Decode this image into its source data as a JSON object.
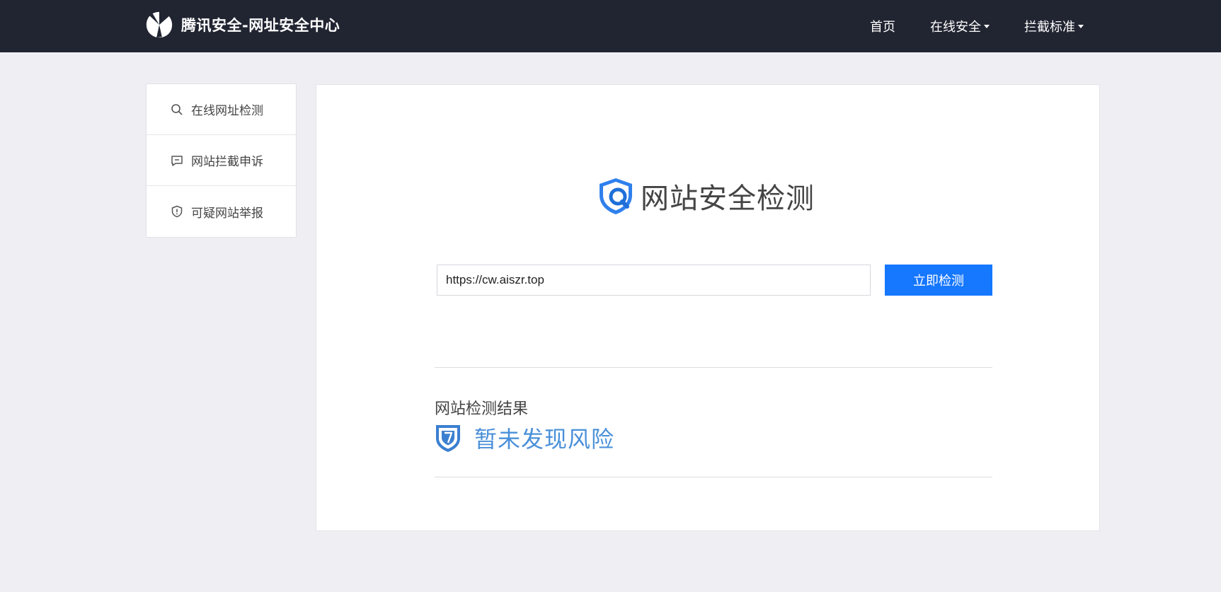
{
  "header": {
    "brand": "腾讯安全-网址安全中心",
    "nav": [
      {
        "label": "首页",
        "dropdown": false
      },
      {
        "label": "在线安全",
        "dropdown": true
      },
      {
        "label": "拦截标准",
        "dropdown": true
      }
    ]
  },
  "sidebar": {
    "items": [
      {
        "label": "在线网址检测",
        "icon": "search-icon"
      },
      {
        "label": "网站拦截申诉",
        "icon": "comment-icon"
      },
      {
        "label": "可疑网站举报",
        "icon": "shield-alert-icon"
      }
    ]
  },
  "main": {
    "title": "网站安全检测",
    "url_value": "https://cw.aiszr.top",
    "check_button": "立即检测",
    "result_label": "网站检测结果",
    "result_status": "暂未发现风险"
  },
  "colors": {
    "header_bg": "#212431",
    "page_bg": "#efeef3",
    "accent": "#1677ff",
    "result_blue": "#4a90d9"
  }
}
